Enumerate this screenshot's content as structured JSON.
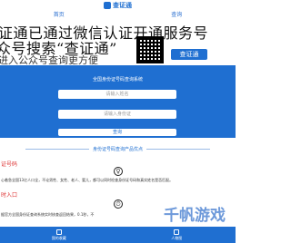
{
  "logo": {
    "text": "查证通"
  },
  "nav": {
    "items": [
      "首页",
      "查询"
    ]
  },
  "banner": {
    "line1": "证通已通过微信认证开通服务号",
    "line2": "众号搜索“查证通”",
    "line3": "进入公众号查询更方便",
    "badge": "查证通"
  },
  "form": {
    "title": "全国身份证号码查询系统",
    "name_placeholder": "请输入姓名",
    "id_placeholder": "请输入身份证",
    "submit_label": "查询"
  },
  "section": {
    "title": "身份证号码查询产品优点"
  },
  "features": [
    {
      "label": "证号码",
      "symbol": "♀",
      "description": "心着急全国13亿人口全，不论男性、女性、老人、婴儿，都可以同时检查身份证号码和真实姓名是否匹配。"
    },
    {
      "label": "时入口",
      "symbol": "⏱",
      "description": "据官方全国身份证查询系统实时核查返回结果，0.1秒，不"
    }
  ],
  "watermark": "千帆游戏",
  "bottom_bar": {
    "tabs": [
      "我的收藏",
      "人物图"
    ]
  }
}
